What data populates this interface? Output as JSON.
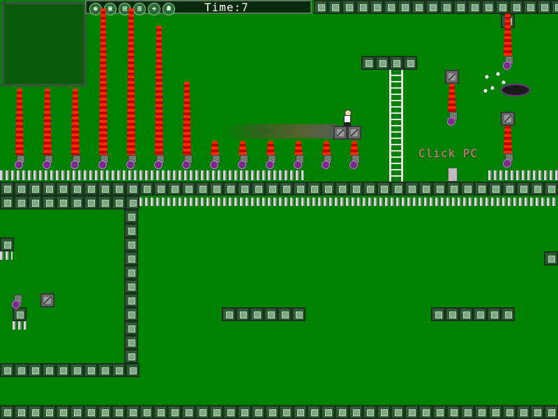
{
  "hud": {
    "time_label": "Time:",
    "time_value": "7",
    "icons": [
      "circle-icon",
      "device-icon",
      "lock-icon",
      "battery-icon",
      "bolt-icon",
      "enemy-icon"
    ],
    "icon_glyphs": [
      "◉",
      "▣",
      "▤",
      "▥",
      "✚",
      "☗"
    ]
  },
  "hint": {
    "click_pc": "Click PC"
  }
}
